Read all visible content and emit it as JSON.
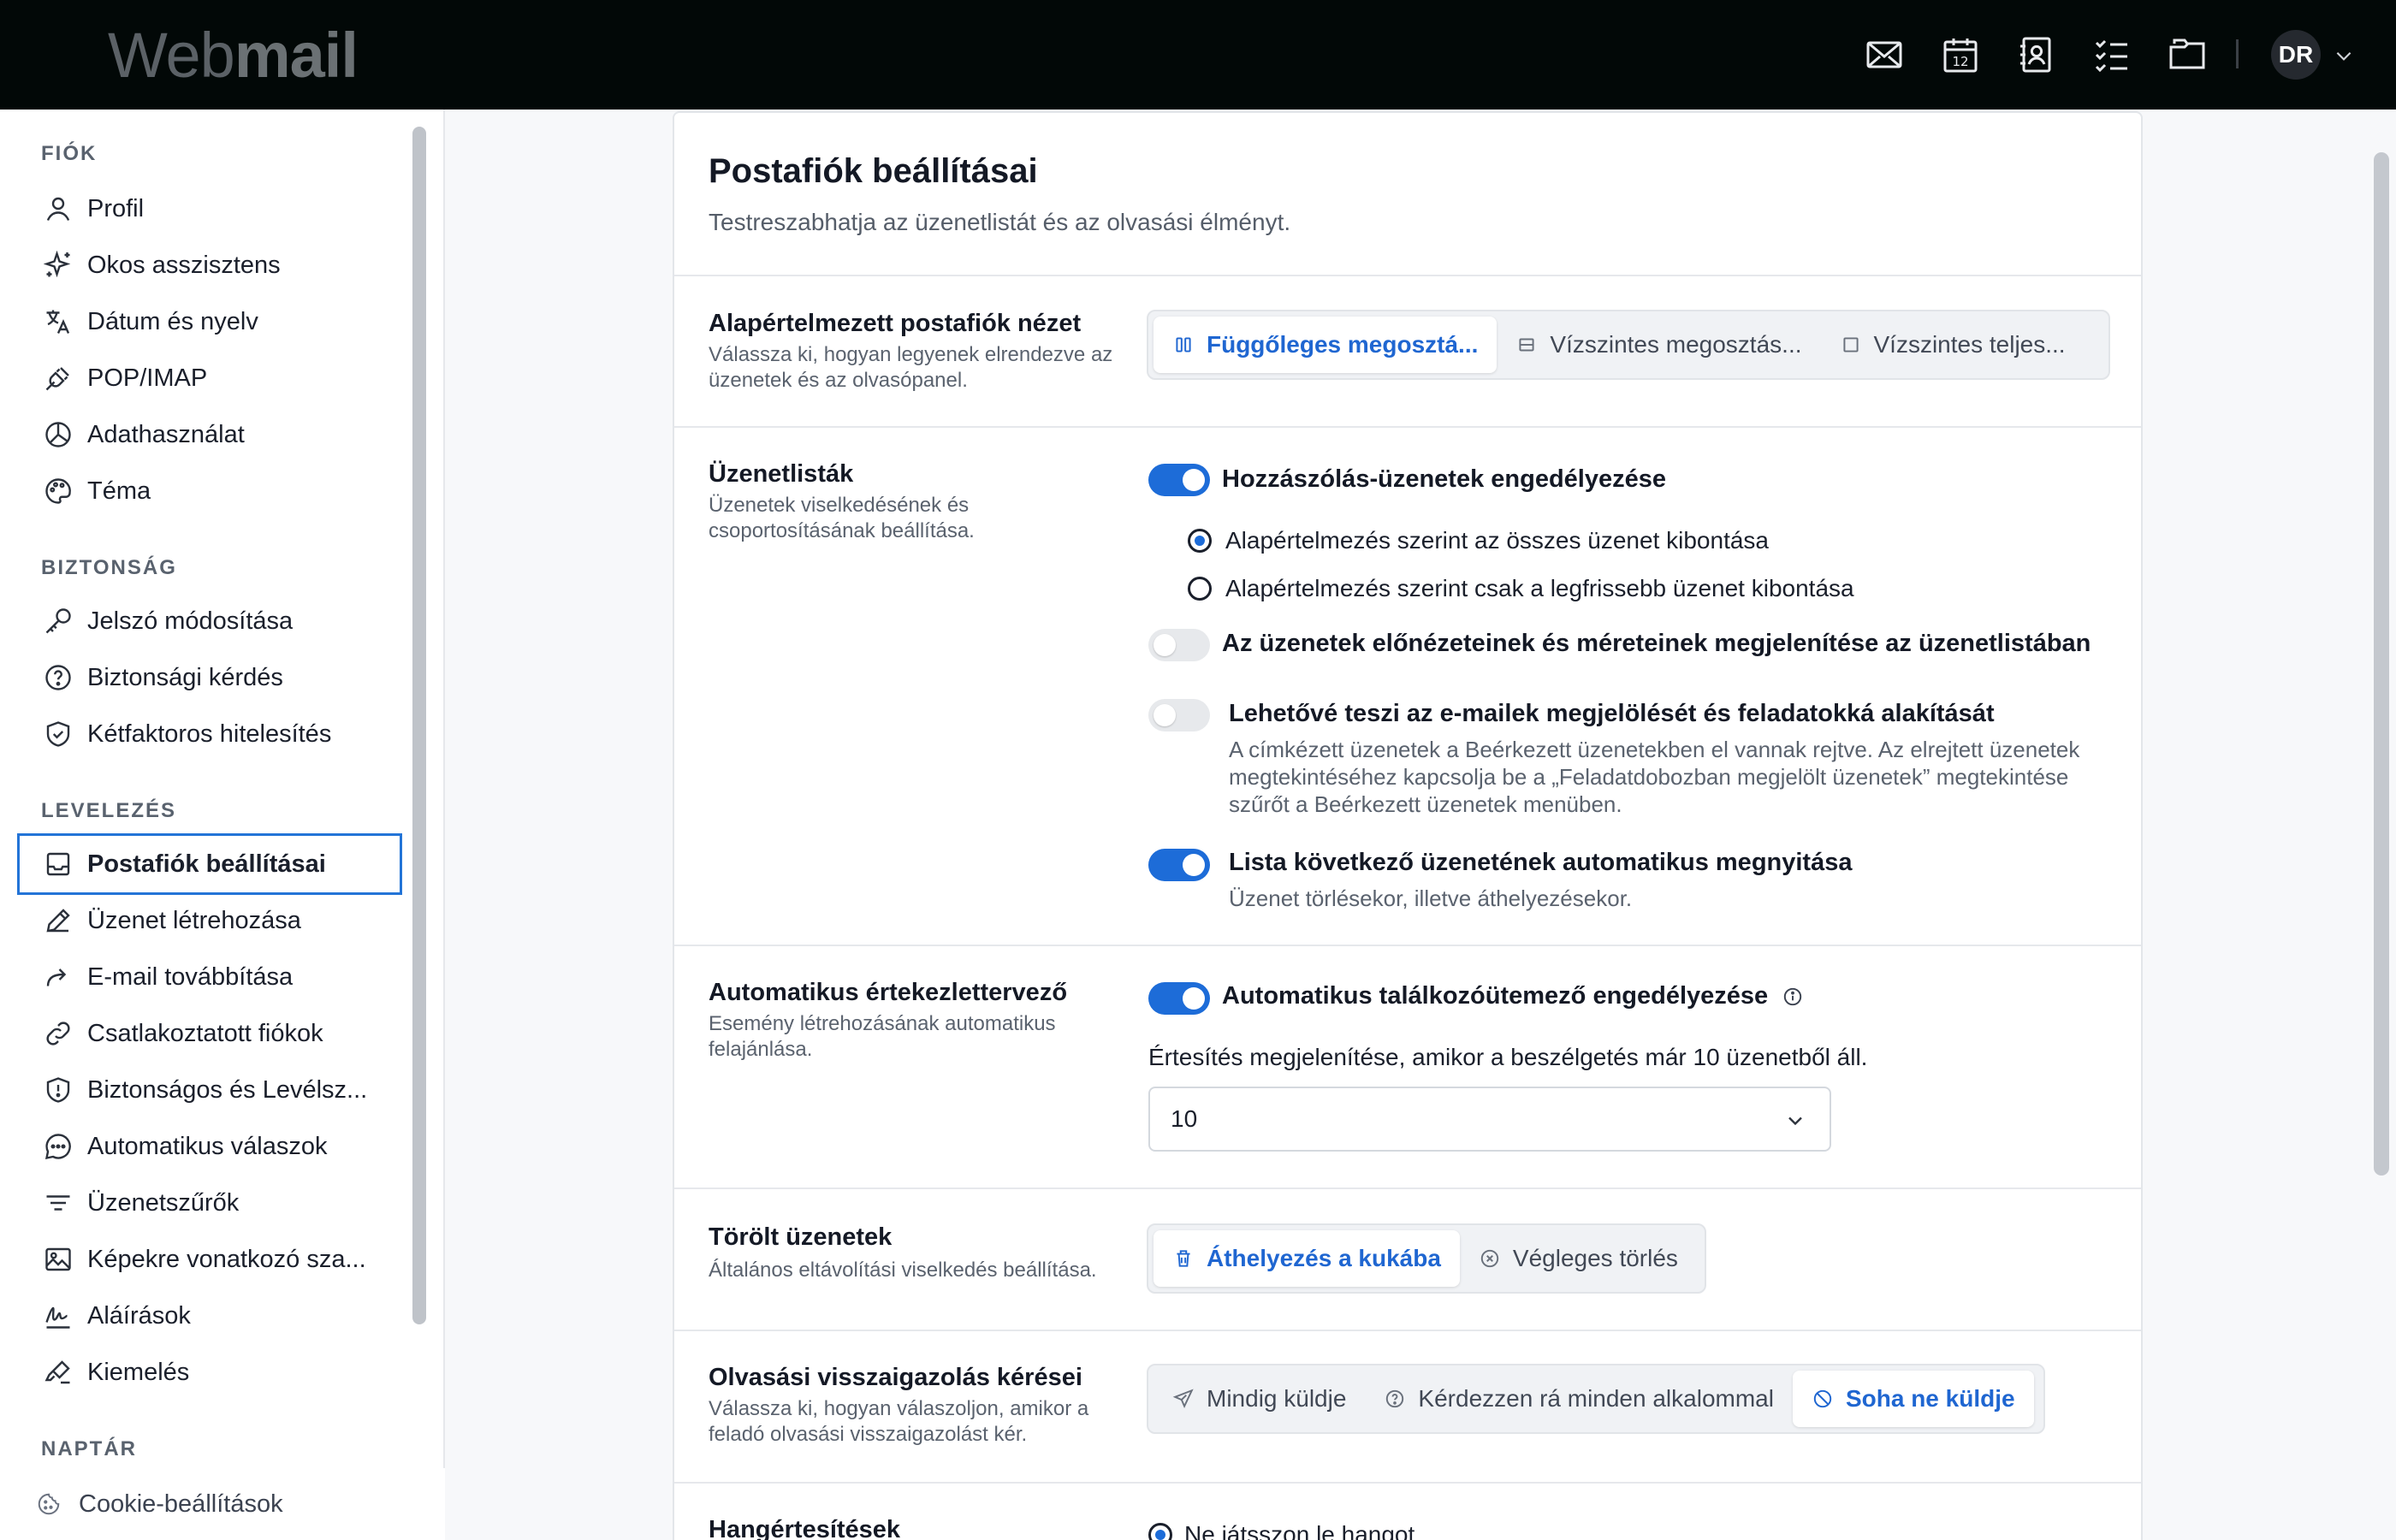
{
  "app": {
    "logo_light": "Web",
    "logo_bold": "mail"
  },
  "topbar": {
    "icons": [
      "mail-icon",
      "calendar-icon",
      "contacts-icon",
      "tasks-icon",
      "folder-icon"
    ],
    "calendar_day": "12",
    "avatar_initials": "DR"
  },
  "sidebar": {
    "sections": [
      {
        "title": "FIÓK",
        "items": [
          "Profil",
          "Okos asszisztens",
          "Dátum és nyelv",
          "POP/IMAP",
          "Adathasználat",
          "Téma"
        ]
      },
      {
        "title": "BIZTONSÁG",
        "items": [
          "Jelszó módosítása",
          "Biztonsági kérdés",
          "Kétfaktoros hitelesítés"
        ]
      },
      {
        "title": "LEVELEZÉS",
        "items": [
          "Postafiók beállításai",
          "Üzenet létrehozása",
          "E-mail továbbítása",
          "Csatlakoztatott fiókok",
          "Biztonságos és Levélsz...",
          "Automatikus válaszok",
          "Üzenetszűrők",
          "Képekre vonatkozó sza...",
          "Aláírások",
          "Kiemelés"
        ]
      },
      {
        "title": "NAPTÁR"
      }
    ],
    "active_item": "Postafiók beállításai",
    "footer": "Cookie-beállítások"
  },
  "main": {
    "title": "Postafiók beállításai",
    "subtitle": "Testreszabhatja az üzenetlistát és az olvasási élményt.",
    "view": {
      "title": "Alapértelmezett postafiók nézet",
      "desc": "Válassza ki, hogyan legyenek elrendezve az üzenetek és az olvasópanel.",
      "options": [
        "Függőleges megosztá...",
        "Vízszintes megosztás...",
        "Vízszintes teljes..."
      ],
      "selected": 0
    },
    "lists": {
      "title": "Üzenetlisták",
      "desc": "Üzenetek viselkedésének és csoportosításának beállítása.",
      "threading": {
        "label": "Hozzászólás-üzenetek engedélyezése",
        "on": true
      },
      "radio1": "Alapértelmezés szerint az összes üzenet kibontása",
      "radio2": "Alapértelmezés szerint csak a legfrissebb üzenet kibontása",
      "radio_selected": 1,
      "previews": {
        "label": "Az üzenetek előnézeteinek és méreteinek megjelenítése az üzenetlistában",
        "on": false
      },
      "tasks": {
        "label": "Lehetővé teszi az e-mailek megjelölését és feladatokká alakítását",
        "desc": "A címkézett üzenetek a Beérkezett üzenetekben el vannak rejtve. Az elrejtett üzenetek megtekintéséhez kapcsolja be a „Feladatdobozban megjelölt üzenetek” megtekintése szűrőt a Beérkezett üzenetek menüben.",
        "on": false
      },
      "autoopen": {
        "label": "Lista következő üzenetének automatikus megnyitása",
        "desc": "Üzenet törlésekor, illetve áthelyezésekor.",
        "on": true
      }
    },
    "scheduler": {
      "title": "Automatikus értekezlettervező",
      "desc": "Esemény létrehozásának automatikus felajánlása.",
      "toggle_label": "Automatikus találkozóütemező engedélyezése",
      "on": true,
      "notice": "Értesítés megjelenítése, amikor a beszélgetés már 10 üzenetből áll.",
      "select_value": "10"
    },
    "deleted": {
      "title": "Törölt üzenetek",
      "desc": "Általános eltávolítási viselkedés beállítása.",
      "options": [
        "Áthelyezés a kukába",
        "Végleges törlés"
      ],
      "selected": 0
    },
    "receipts": {
      "title": "Olvasási visszaigazolás kérései",
      "desc": "Válassza ki, hogyan válaszoljon, amikor a feladó olvasási visszaigazolást kér.",
      "options": [
        "Mindig küldje",
        "Kérdezzen rá minden alkalommal",
        "Soha ne küldje"
      ],
      "selected": 2
    },
    "sounds": {
      "title": "Hangértesítések",
      "option": "Ne játsszon le hangot"
    }
  }
}
